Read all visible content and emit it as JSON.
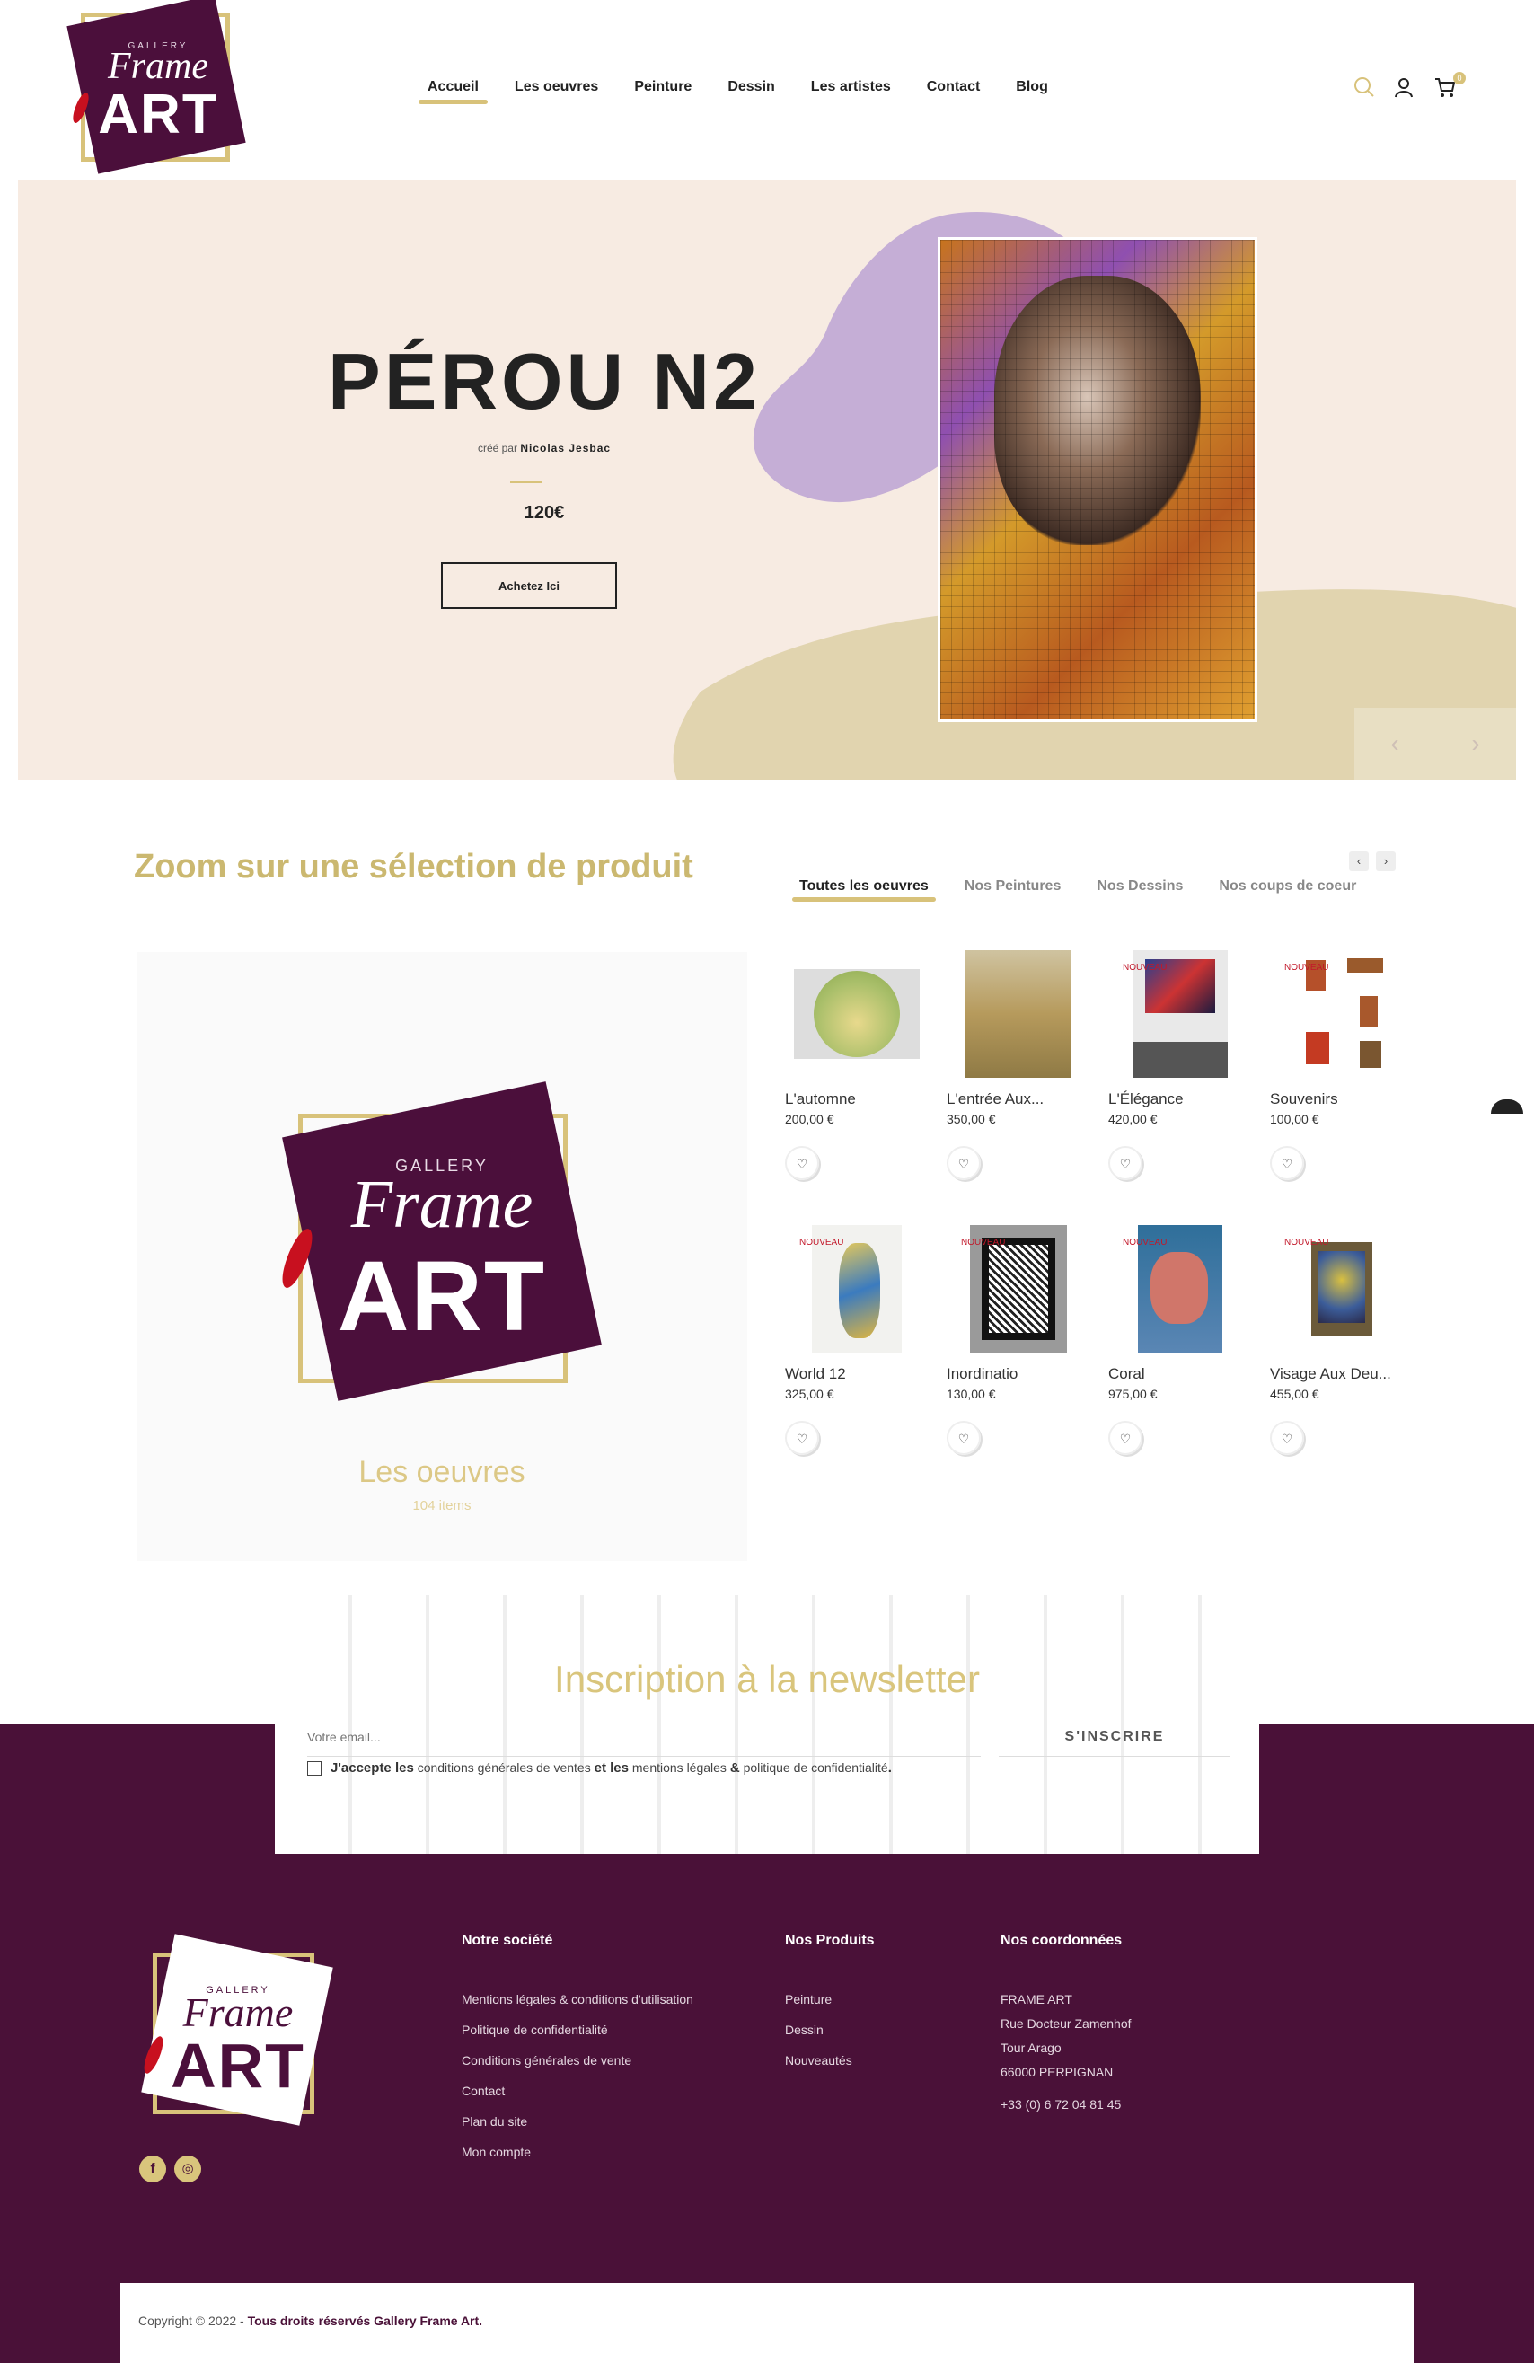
{
  "brand": {
    "gallery": "GALLERY",
    "frame": "Frame",
    "art": "ART",
    "colors": {
      "plum": "#4b0f3b",
      "gold": "#d8c27a",
      "red": "#c8101f"
    }
  },
  "nav": {
    "items": [
      "Accueil",
      "Les oeuvres",
      "Peinture",
      "Dessin",
      "Les artistes",
      "Contact",
      "Blog"
    ],
    "active": "Accueil",
    "cart_count": "0",
    "icons": [
      "search-icon",
      "user-icon",
      "cart-icon"
    ]
  },
  "hero": {
    "title": "PÉROU N2",
    "by_prefix": "créé par",
    "artist": "Nicolas Jesbac",
    "price": "120€",
    "button": "Achetez Ici",
    "prev": "‹",
    "next": "›"
  },
  "selection": {
    "title": "Zoom sur une sélection de produit",
    "tabs": [
      "Toutes les oeuvres",
      "Nos Peintures",
      "Nos Dessins",
      "Nos coups de coeur"
    ],
    "active_tab": "Toutes les oeuvres",
    "nav_prev": "‹",
    "nav_next": "›"
  },
  "promo": {
    "title": "Les oeuvres",
    "count": "104 items"
  },
  "products": [
    {
      "name": "L'automne",
      "price": "200,00 €",
      "badge": ""
    },
    {
      "name": "L'entrée Aux...",
      "price": "350,00 €",
      "badge": ""
    },
    {
      "name": "L'Élégance",
      "price": "420,00 €",
      "badge": "NOUVEAU"
    },
    {
      "name": "Souvenirs",
      "price": "100,00 €",
      "badge": "NOUVEAU"
    },
    {
      "name": "World 12",
      "price": "325,00 €",
      "badge": "NOUVEAU"
    },
    {
      "name": "Inordinatio",
      "price": "130,00 €",
      "badge": "NOUVEAU"
    },
    {
      "name": "Coral",
      "price": "975,00 €",
      "badge": "NOUVEAU"
    },
    {
      "name": "Visage Aux Deu...",
      "price": "455,00 €",
      "badge": "NOUVEAU"
    }
  ],
  "newsletter": {
    "title": "Inscription à la newsletter",
    "placeholder": "Votre email...",
    "button": "S'INSCRIRE",
    "consent": {
      "a": "J'accepte les",
      "b": "conditions générales de ventes",
      "c": "et les",
      "d": "mentions légales",
      "e": "&",
      "f": "politique de confidentialité",
      "g": "."
    }
  },
  "footer": {
    "col1": {
      "title": "Notre société",
      "links": [
        "Mentions légales & conditions d'utilisation",
        "Politique de confidentialité",
        "Conditions générales de vente",
        "Contact",
        "Plan du site",
        "Mon compte"
      ]
    },
    "col2": {
      "title": "Nos Produits",
      "links": [
        "Peinture",
        "Dessin",
        "Nouveautés"
      ]
    },
    "col3": {
      "title": "Nos coordonnées",
      "lines": [
        "FRAME ART",
        "Rue Docteur Zamenhof",
        "Tour Arago",
        "66000 PERPIGNAN"
      ],
      "phone": "+33 (0) 6 72 04 81 45"
    },
    "social": [
      "f",
      "◎"
    ]
  },
  "copyright": {
    "text": "Copyright © 2022 - ",
    "bold": "Tous droits réservés Gallery Frame Art."
  }
}
